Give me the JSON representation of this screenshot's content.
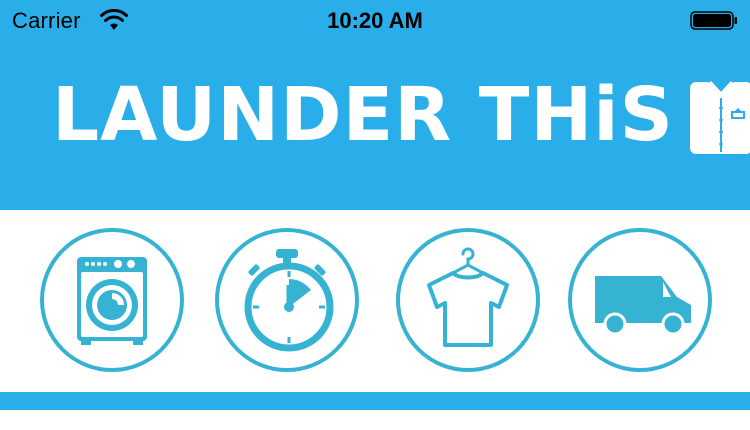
{
  "status_bar": {
    "carrier": "Carrier",
    "time": "10:20 AM",
    "wifi_icon": "wifi-icon",
    "battery_icon": "battery-full-icon"
  },
  "header": {
    "logo_text": "LAUNDER THiS",
    "logo_icon": "shirt-with-tie-icon",
    "background_color": "#2aaee9"
  },
  "services": [
    {
      "icon": "washing-machine-icon"
    },
    {
      "icon": "stopwatch-icon"
    },
    {
      "icon": "shirt-on-hanger-icon"
    },
    {
      "icon": "delivery-van-icon"
    }
  ],
  "colors": {
    "brand_blue": "#2aaee9",
    "icon_teal": "#36b3d3",
    "white": "#ffffff"
  }
}
